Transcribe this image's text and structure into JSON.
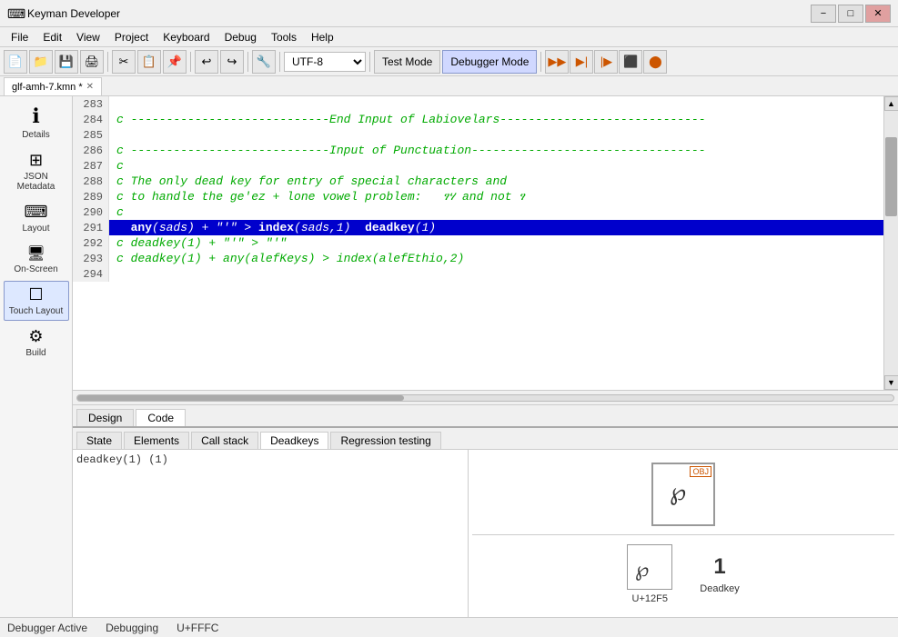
{
  "app": {
    "title": "Keyman Developer",
    "icon": "⌨"
  },
  "titlebar": {
    "minimize": "−",
    "maximize": "□",
    "close": "✕"
  },
  "menu": {
    "items": [
      "File",
      "Edit",
      "View",
      "Project",
      "Keyboard",
      "Debug",
      "Tools",
      "Help"
    ]
  },
  "toolbar": {
    "encoding": "UTF-8",
    "test_mode": "Test Mode",
    "debugger_mode": "Debugger Mode"
  },
  "file_tab": {
    "name": "glf-amh-7.kmn",
    "modified": true
  },
  "sidebar": {
    "items": [
      {
        "id": "details",
        "label": "Details",
        "icon": "ℹ"
      },
      {
        "id": "json-metadata",
        "label": "JSON Metadata",
        "icon": "⊞"
      },
      {
        "id": "layout",
        "label": "Layout",
        "icon": "⌨"
      },
      {
        "id": "on-screen",
        "label": "On-Screen",
        "icon": "🖥"
      },
      {
        "id": "touch-layout",
        "label": "Touch Layout",
        "icon": "☐",
        "active": true
      },
      {
        "id": "build",
        "label": "Build",
        "icon": "⚙"
      }
    ]
  },
  "code_lines": [
    {
      "num": "283",
      "content": "",
      "highlighted": false
    },
    {
      "num": "284",
      "content": "c ----------------------------End Input of Labiovelars-----------------------------",
      "highlighted": false
    },
    {
      "num": "285",
      "content": "",
      "highlighted": false
    },
    {
      "num": "286",
      "content": "c ----------------------------Input of Punctuation---------------------------------",
      "highlighted": false
    },
    {
      "num": "287",
      "content": "c",
      "highlighted": false
    },
    {
      "num": "288",
      "content": "c The only dead key for entry of special characters and",
      "highlighted": false
    },
    {
      "num": "289",
      "content": "c to handle the ge'ez + lone vowel problem:   ፃሃ and not ፃ",
      "highlighted": false
    },
    {
      "num": "290",
      "content": "c",
      "highlighted": false
    },
    {
      "num": "291",
      "content": "  any(sads) + \"'\" > index(sads,1)  deadkey(1)",
      "highlighted": true
    },
    {
      "num": "292",
      "content": "c deadkey(1) + \"'\" > \"'\"",
      "highlighted": false
    },
    {
      "num": "293",
      "content": "c deadkey(1) + any(alefKeys) > index(alefEthio,2)",
      "highlighted": false
    },
    {
      "num": "294",
      "content": "",
      "highlighted": false
    }
  ],
  "editor_tabs": [
    {
      "label": "Design",
      "active": false
    },
    {
      "label": "Code",
      "active": true
    }
  ],
  "bottom_tabs": [
    {
      "label": "State",
      "active": false
    },
    {
      "label": "Elements",
      "active": false
    },
    {
      "label": "Call stack",
      "active": false
    },
    {
      "label": "Deadkeys",
      "active": true
    },
    {
      "label": "Regression testing",
      "active": false
    }
  ],
  "deadkeys_content": "deadkey(1) (1)",
  "char_display": {
    "glyph_top": "℘",
    "obj_label": "OBJ",
    "glyph_bottom": "℘",
    "codepoint": "U+12F5",
    "value": "1",
    "type": "Deadkey"
  },
  "status_bar": {
    "items": [
      "Debugger Active",
      "Debugging",
      "U+FFFC"
    ]
  }
}
